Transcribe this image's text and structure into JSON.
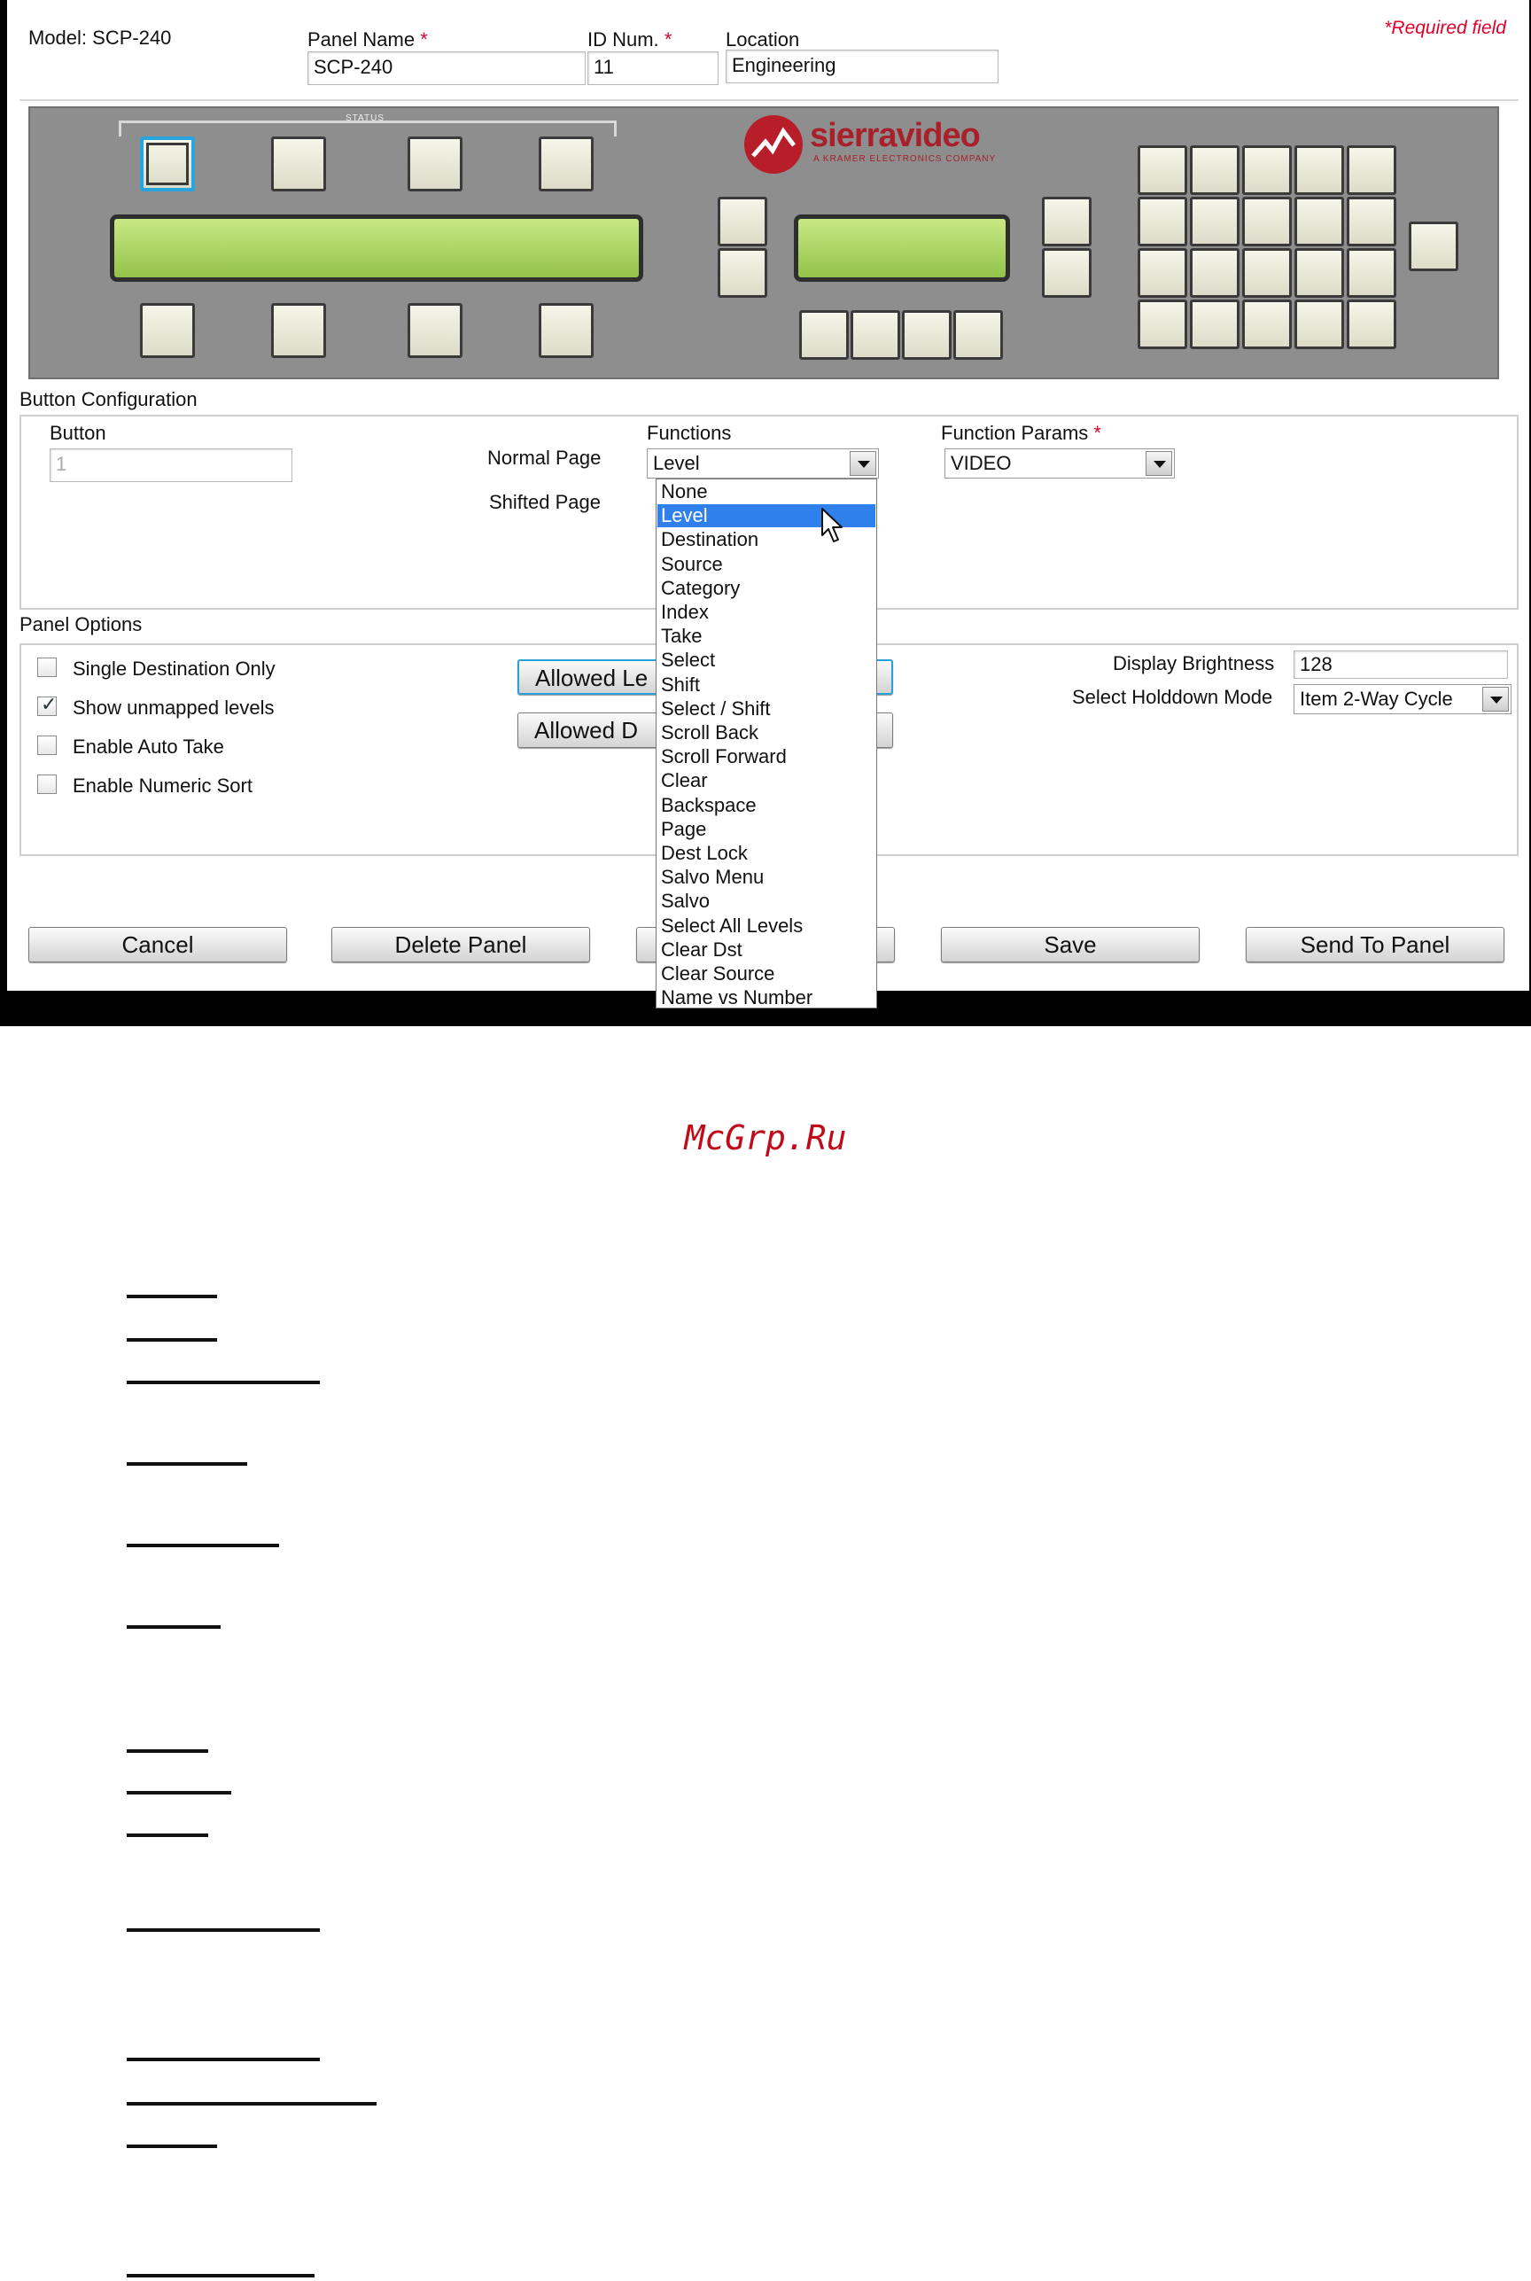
{
  "header": {
    "model": "Model: SCP-240",
    "panel_name_label": "Panel Name",
    "panel_name_value": "SCP-240",
    "id_label": "ID Num.",
    "id_value": "11",
    "location_label": "Location",
    "location_value": "Engineering",
    "required_mark": "*",
    "required_note": "*Required field"
  },
  "panel_image": {
    "brand": "sierravideo",
    "brand_sub": "A KRAMER ELECTRONICS COMPANY",
    "status_label": "STATUS"
  },
  "button_config": {
    "title": "Button Configuration",
    "button_label": "Button",
    "button_value": "1",
    "normal_page_label": "Normal Page",
    "shifted_page_label": "Shifted Page",
    "functions_label": "Functions",
    "functions_value": "Level",
    "function_params_label": "Function Params",
    "function_params_value": "VIDEO"
  },
  "function_options": [
    "None",
    "Level",
    "Destination",
    "Source",
    "Category",
    "Index",
    "Take",
    "Select",
    "Shift",
    "Select / Shift",
    "Scroll Back",
    "Scroll Forward",
    "Clear",
    "Backspace",
    "Page",
    "Dest Lock",
    "Salvo Menu",
    "Salvo",
    "Select All Levels",
    "Clear Dst",
    "Clear Source",
    "Name vs Number"
  ],
  "function_selected_index": 1,
  "panel_options": {
    "title": "Panel Options",
    "single_destination": "Single Destination Only",
    "single_destination_checked": false,
    "show_unmapped": "Show unmapped levels",
    "show_unmapped_checked": true,
    "auto_take": "Enable Auto Take",
    "auto_take_checked": false,
    "numeric_sort": "Enable Numeric Sort",
    "numeric_sort_checked": false,
    "allowed_levels_btn": "Allowed Le",
    "allowed_dest_btn": "Allowed D",
    "display_brightness_label": "Display Brightness",
    "display_brightness_value": "128",
    "holddown_label": "Select Holddown Mode",
    "holddown_value": "Item 2-Way Cycle"
  },
  "actions": {
    "cancel": "Cancel",
    "delete": "Delete Panel",
    "save": "Save",
    "send": "Send To Panel"
  },
  "watermark": "McGrp.Ru",
  "colors": {
    "required": "#e0002a",
    "highlight": "#2f80ea",
    "panel_bg": "#8e8e8e",
    "lcd": "#a6d15b",
    "selected_button_border": "#2aa4dd",
    "watermark": "#c00c1a"
  }
}
